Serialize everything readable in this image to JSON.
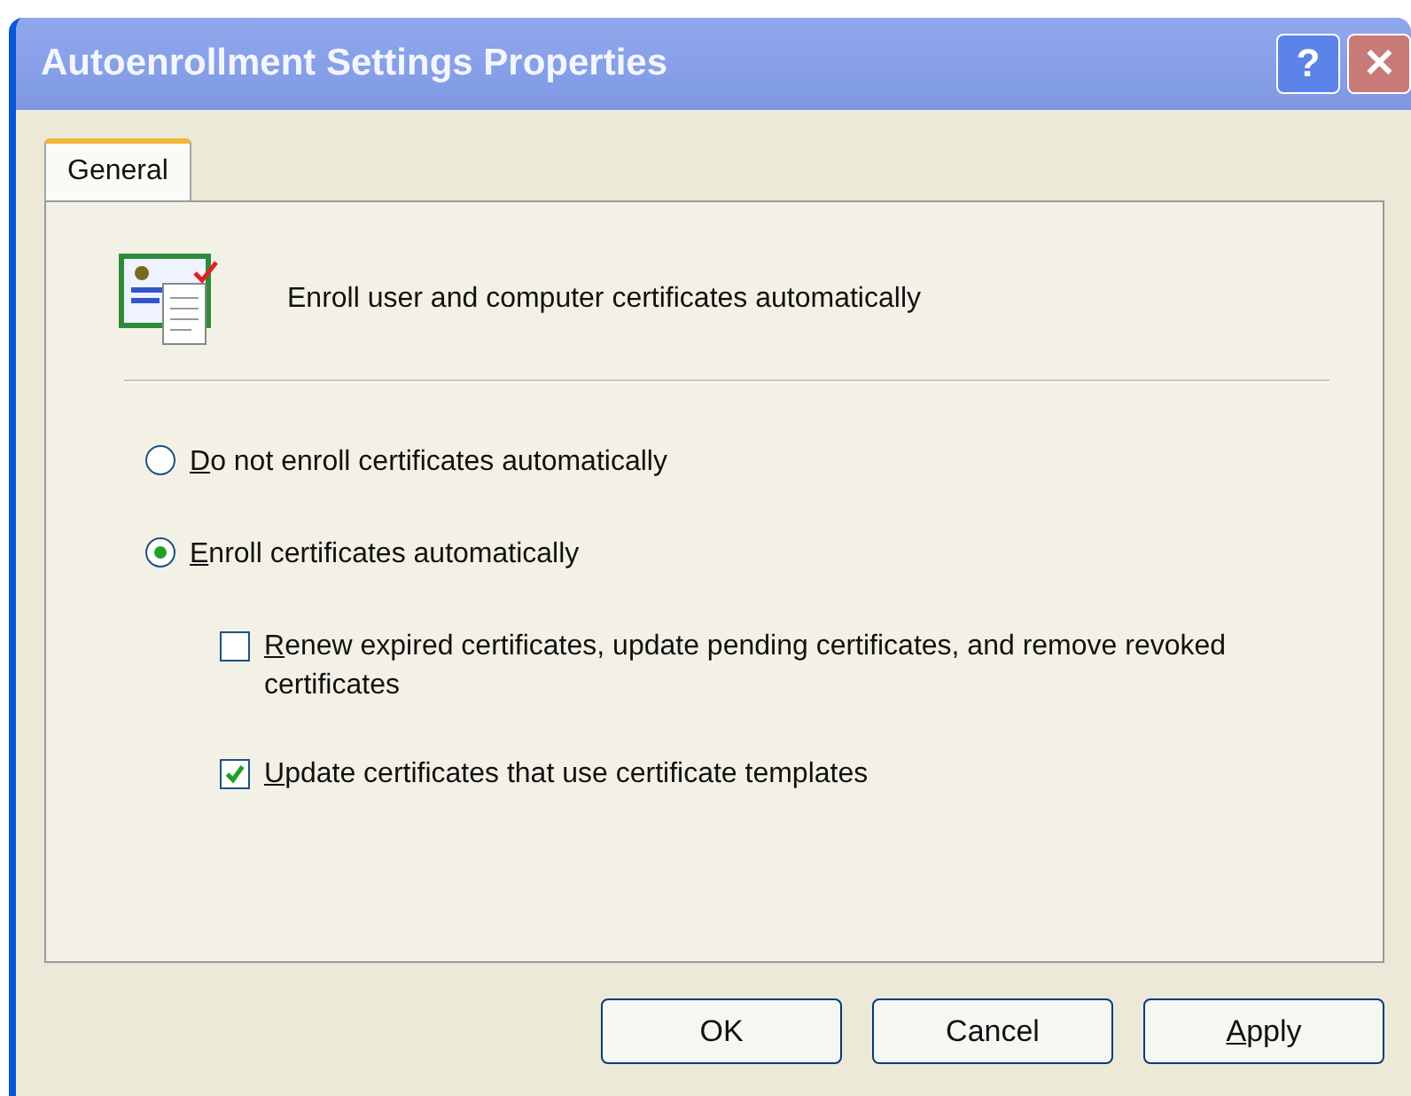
{
  "window": {
    "title": "Autoenrollment Settings Properties",
    "help_button": "?",
    "close_button": "✕"
  },
  "tabs": [
    {
      "label": "General",
      "selected": true
    }
  ],
  "header": {
    "text": "Enroll user and computer certificates automatically"
  },
  "options": [
    {
      "kind": "radio",
      "label": "Do not enroll certificates automatically",
      "selected": false,
      "mnemonic_underlined": true
    },
    {
      "kind": "radio",
      "label": "Enroll certificates automatically",
      "selected": true,
      "mnemonic_underlined": true
    },
    {
      "kind": "checkbox",
      "label": "Renew expired certificates, update pending certificates, and remove revoked certificates",
      "checked": false,
      "mnemonic_underlined": true
    },
    {
      "kind": "checkbox",
      "label": "Update certificates that use certificate templates",
      "checked": true,
      "mnemonic_underlined": true
    }
  ],
  "buttons": [
    {
      "label": "OK",
      "mnemonic_underlined": false
    },
    {
      "label": "Cancel",
      "mnemonic_underlined": false
    },
    {
      "label": "Apply",
      "mnemonic_underlined": true
    }
  ]
}
